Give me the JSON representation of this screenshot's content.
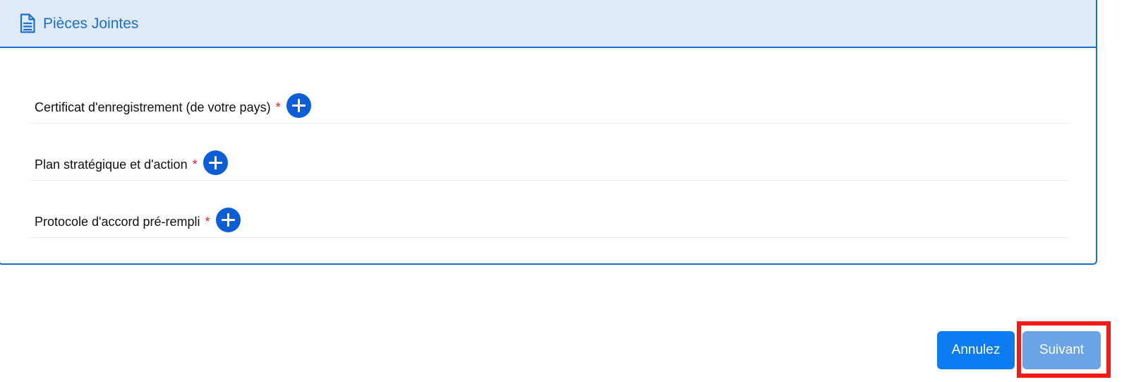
{
  "section": {
    "title": "Pièces Jointes",
    "icon": "document-icon"
  },
  "attachments": [
    {
      "label": "Certificat d'enregistrement (de votre pays)",
      "required": "*"
    },
    {
      "label": "Plan stratégique et d'action",
      "required": "*"
    },
    {
      "label": "Protocole d'accord pré-rempli",
      "required": "*"
    }
  ],
  "actions": {
    "cancel_label": "Annulez",
    "next_label": "Suivant"
  },
  "colors": {
    "accent": "#1a6fd1",
    "header_bg": "#deeaf7",
    "required": "#e0202a",
    "cancel_button": "#0d7cf2",
    "next_button": "#6aa3e6",
    "highlight": "#f21a12"
  }
}
